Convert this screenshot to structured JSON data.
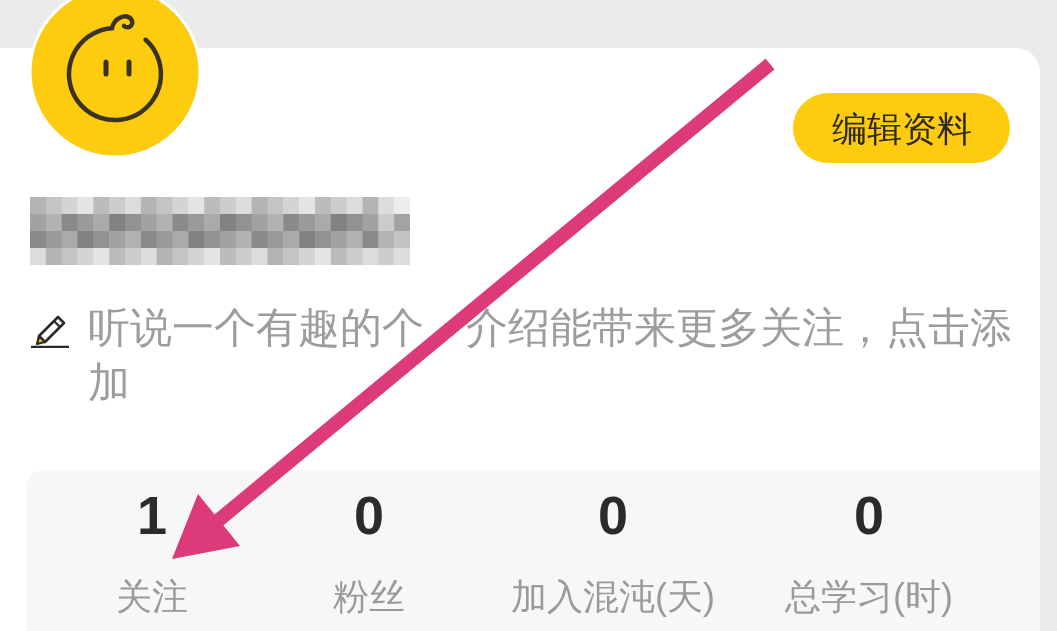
{
  "profile": {
    "edit_button": "编辑资料",
    "bio_visible_parts": [
      "听说一个有趣的个",
      "介绍能带来更多关注，点击添",
      "加"
    ]
  },
  "stats": [
    {
      "value": "1",
      "label": "关注"
    },
    {
      "value": "0",
      "label": "粉丝"
    },
    {
      "value": "0",
      "label": "加入混沌(天)"
    },
    {
      "value": "0",
      "label": "总学习(时)"
    }
  ]
}
